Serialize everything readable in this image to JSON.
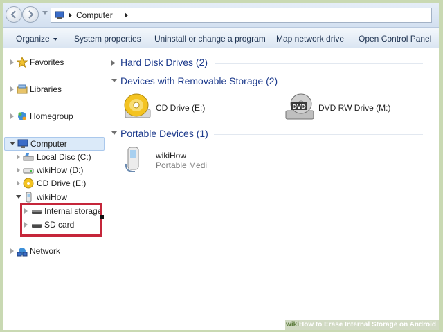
{
  "address_bar": {
    "path": [
      "Computer"
    ]
  },
  "toolbar": {
    "organize": "Organize",
    "system_properties": "System properties",
    "uninstall": "Uninstall or change a program",
    "map_network_drive": "Map network drive",
    "open_control_panel": "Open Control Panel"
  },
  "nav_tree": {
    "favorites": "Favorites",
    "libraries": "Libraries",
    "homegroup": "Homegroup",
    "computer": "Computer",
    "local_disc": "Local Disc (C:)",
    "wikihow_d": "wikiHow (D:)",
    "cd_drive_e": "CD Drive (E:)",
    "wikihow_device": "wikiHow",
    "internal_storage": "Internal storage",
    "sd_card": "SD card",
    "network": "Network"
  },
  "content": {
    "hard_disk_drives": "Hard Disk Drives (2)",
    "removable_storage": "Devices with Removable Storage (2)",
    "cd_drive": "CD Drive (E:)",
    "dvd_drive": "DVD RW Drive (M:)",
    "dvd_badge": "DVD",
    "portable_devices": "Portable Devices (1)",
    "device_name": "wikiHow",
    "device_type": "Portable Medi"
  },
  "watermark": {
    "brand": "wiki",
    "caption": "How to Erase Internal Storage on Android"
  },
  "colors": {
    "highlight_box": "#c5263a",
    "group_title": "#1c3a8c",
    "selection": "#dbeaf9"
  }
}
